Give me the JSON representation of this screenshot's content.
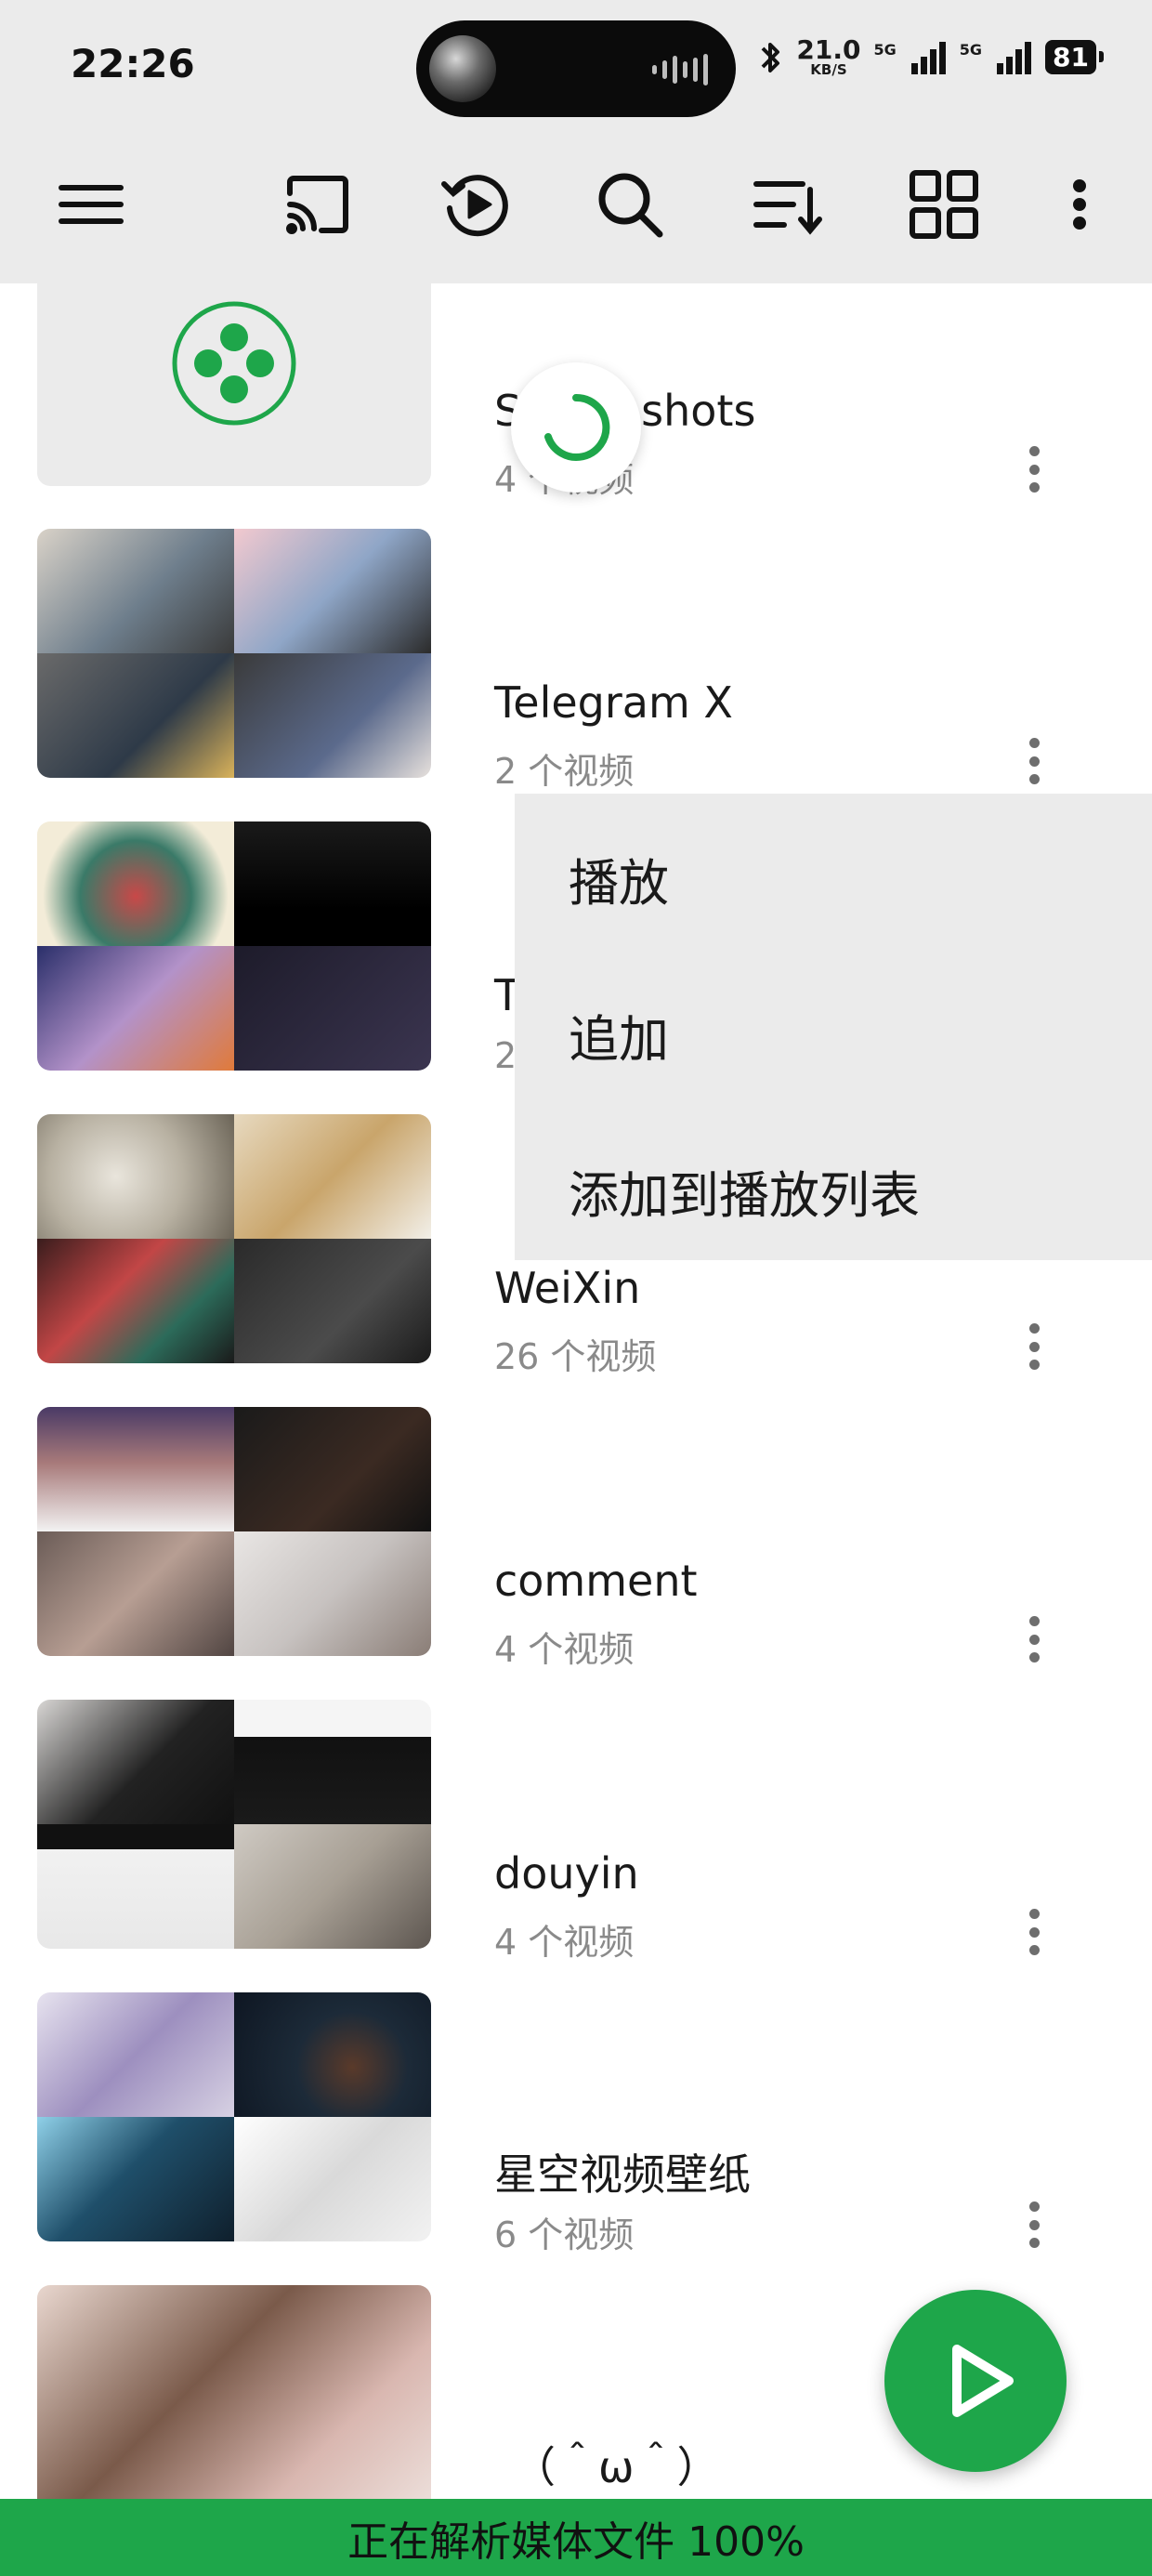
{
  "status_bar": {
    "time": "22:26",
    "net_speed_value": "21.0",
    "net_speed_unit": "KB/S",
    "signal1_label": "5G",
    "signal2_label": "5G",
    "battery": "81"
  },
  "toolbar": {
    "icons": [
      "menu-icon",
      "cast-icon",
      "history-icon",
      "search-icon",
      "sort-icon",
      "grid-view-icon",
      "more-icon"
    ]
  },
  "folders": [
    {
      "title": "Screenshots",
      "subtitle": "4 个视频"
    },
    {
      "title": "Telegram X",
      "subtitle": "2 个视频"
    },
    {
      "title": "T",
      "subtitle": "2"
    },
    {
      "title": "WeiXin",
      "subtitle": "26 个视频"
    },
    {
      "title": "comment",
      "subtitle": "4 个视频"
    },
    {
      "title": "douyin",
      "subtitle": "4 个视频"
    },
    {
      "title": "星空视频壁纸",
      "subtitle": "6 个视频"
    },
    {
      "title": "（＾ω＾）",
      "subtitle": ""
    }
  ],
  "context_menu": {
    "items": [
      "播放",
      "追加",
      "添加到播放列表"
    ]
  },
  "status_message": "正在解析媒体文件 100%",
  "colors": {
    "accent": "#1ea64a",
    "toolbar_bg": "#ebebeb",
    "menu_bg": "#ebebeb"
  }
}
